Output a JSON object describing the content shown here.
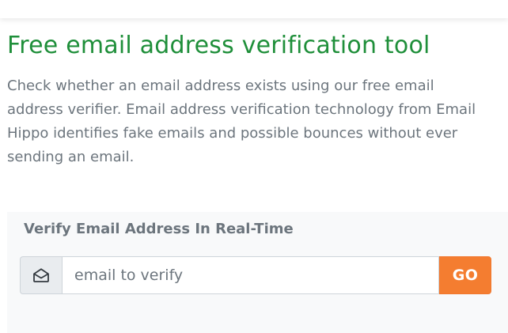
{
  "hero": {
    "title": "Free email address verification tool",
    "description": "Check whether an email address exists using our free email address verifier. Email address verification technology from Email Hippo identifies fake emails and possible bounces without ever sending an email."
  },
  "verify_panel": {
    "heading": "Verify Email Address In Real-Time",
    "input": {
      "value": "",
      "placeholder": "email to verify"
    },
    "go_label": "GO",
    "prefix_icon": "envelope-open-icon"
  },
  "colors": {
    "title": "#1f8f3a",
    "text_muted": "#6c757d",
    "panel_background": "#f8f9fa",
    "go_button": "#f47d30",
    "prefix_background": "#e9ecef",
    "border": "#ced4da"
  }
}
